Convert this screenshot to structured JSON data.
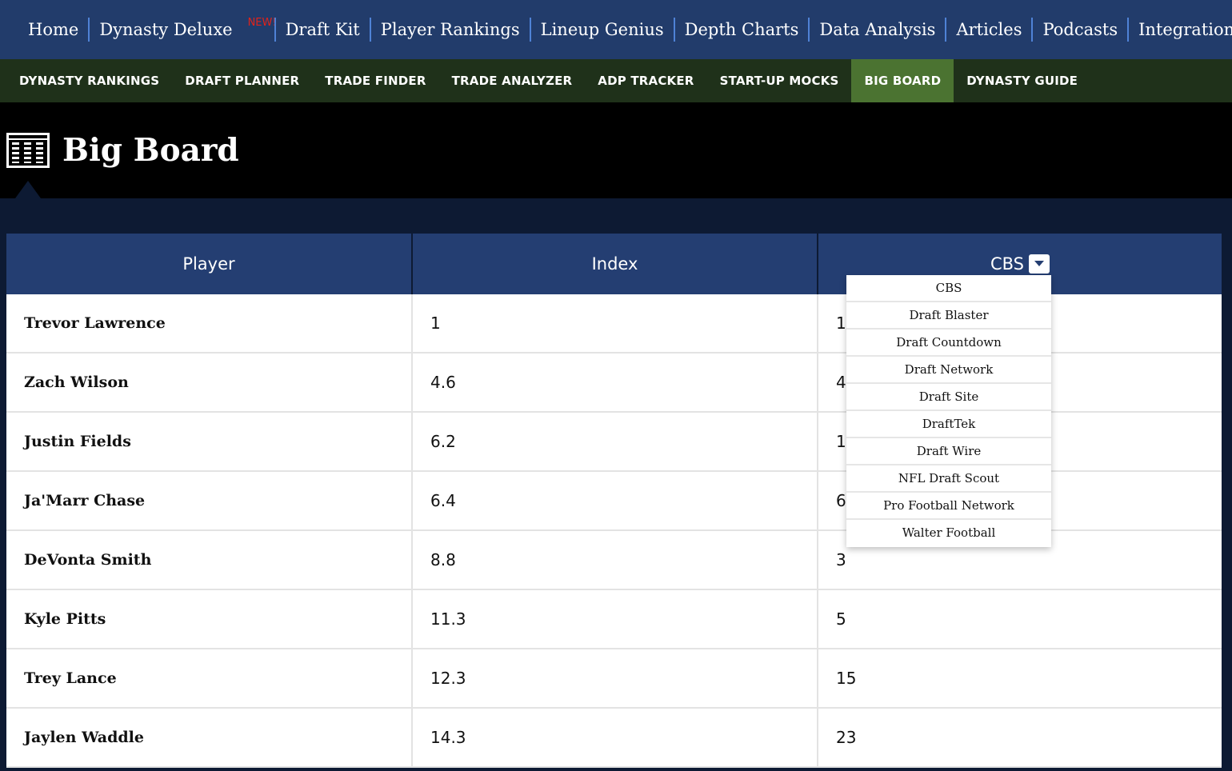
{
  "top_nav": [
    {
      "label": "Home"
    },
    {
      "label": "Dynasty Deluxe",
      "badge": "NEW!"
    },
    {
      "label": "Draft Kit"
    },
    {
      "label": "Player Rankings"
    },
    {
      "label": "Lineup Genius"
    },
    {
      "label": "Depth Charts"
    },
    {
      "label": "Data Analysis"
    },
    {
      "label": "Articles"
    },
    {
      "label": "Podcasts"
    },
    {
      "label": "Integration"
    }
  ],
  "sub_nav": [
    {
      "label": "DYNASTY RANKINGS"
    },
    {
      "label": "DRAFT PLANNER"
    },
    {
      "label": "TRADE FINDER"
    },
    {
      "label": "TRADE ANALYZER"
    },
    {
      "label": "ADP TRACKER"
    },
    {
      "label": "START-UP MOCKS"
    },
    {
      "label": "BIG BOARD",
      "active": true
    },
    {
      "label": "DYNASTY GUIDE"
    }
  ],
  "page": {
    "title": "Big Board",
    "icon": "big-board-icon"
  },
  "table": {
    "headers": [
      "Player",
      "Index",
      "CBS"
    ],
    "rows": [
      {
        "player": "Trevor Lawrence",
        "index": "1",
        "source": "1"
      },
      {
        "player": "Zach Wilson",
        "index": "4.6",
        "source": "4"
      },
      {
        "player": "Justin Fields",
        "index": "6.2",
        "source": "1"
      },
      {
        "player": "Ja'Marr Chase",
        "index": "6.4",
        "source": "6"
      },
      {
        "player": "DeVonta Smith",
        "index": "8.8",
        "source": "3"
      },
      {
        "player": "Kyle Pitts",
        "index": "11.3",
        "source": "5"
      },
      {
        "player": "Trey Lance",
        "index": "12.3",
        "source": "15"
      },
      {
        "player": "Jaylen Waddle",
        "index": "14.3",
        "source": "23"
      }
    ]
  },
  "source_dropdown": {
    "selected": "CBS",
    "options": [
      "CBS",
      "Draft Blaster",
      "Draft Countdown",
      "Draft Network",
      "Draft Site",
      "DraftTek",
      "Draft Wire",
      "NFL Draft Scout",
      "Pro Football Network",
      "Walter Football"
    ]
  },
  "colors": {
    "top_nav_bg": "#223c6b",
    "sub_nav_bg": "#1f311a",
    "sub_nav_active": "#4b7331",
    "table_header_bg": "#243e72",
    "badge": "#e2231a"
  }
}
